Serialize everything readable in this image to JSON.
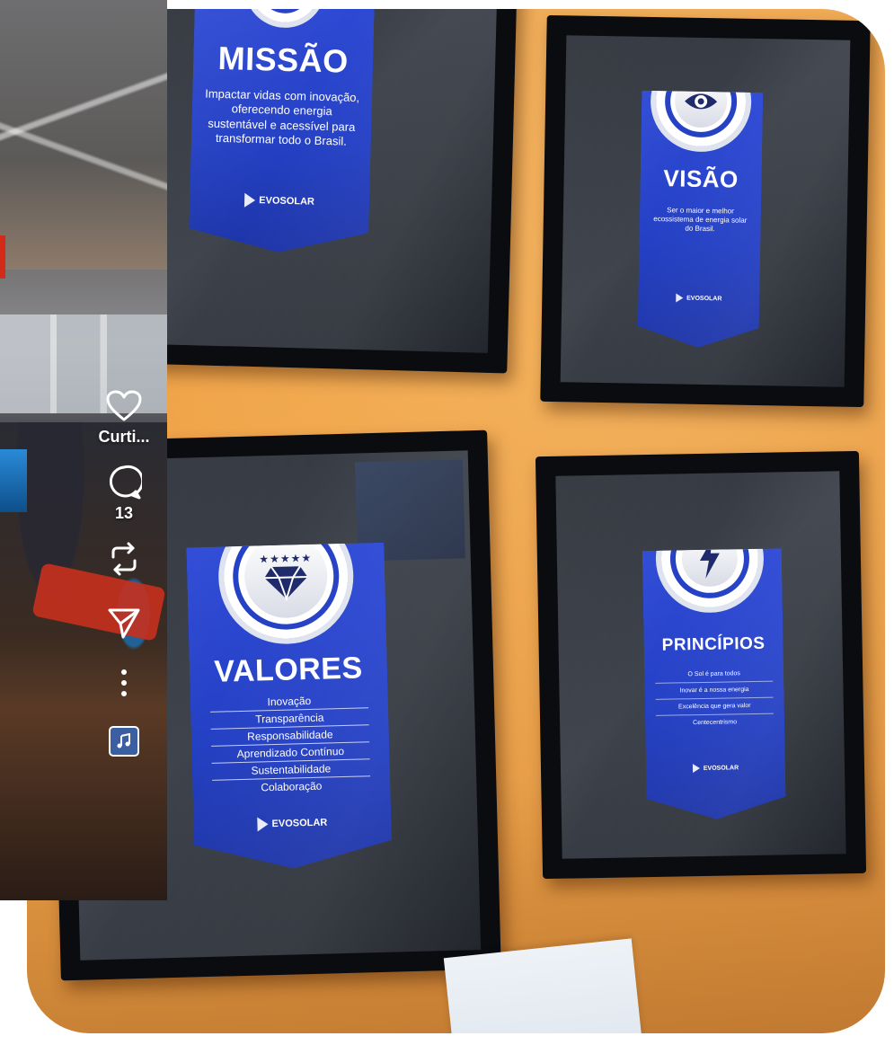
{
  "frames": {
    "missao": {
      "title": "MISSÃO",
      "text": "Impactar vidas com inovação, oferecendo energia sustentável e acessível para transformar todo o Brasil.",
      "brand": "EVOSOLAR"
    },
    "visao": {
      "title": "VISÃO",
      "text": "Ser o maior e melhor ecossistema de energia solar do Brasil.",
      "brand": "EVOSOLAR"
    },
    "valores": {
      "title": "VALORES",
      "items": [
        "Inovação",
        "Transparência",
        "Responsabilidade",
        "Aprendizado Contínuo",
        "Sustentabilidade",
        "Colaboração"
      ],
      "brand": "EVOSOLAR"
    },
    "principios": {
      "title": "PRINCÍPIOS",
      "items": [
        "O Sol é para todos",
        "Inovar é a nossa energia",
        "Excelência que gera valor",
        "Centecentrismo"
      ],
      "brand": "EVOSOLAR"
    }
  },
  "reel": {
    "like_label": "Curti...",
    "comment_count": "13",
    "icons": {
      "like": "heart-icon",
      "comment": "comment-bubble-icon",
      "repost": "repost-icon",
      "share": "send-icon",
      "more": "more-vertical-icon",
      "audio": "music-note-icon"
    }
  }
}
